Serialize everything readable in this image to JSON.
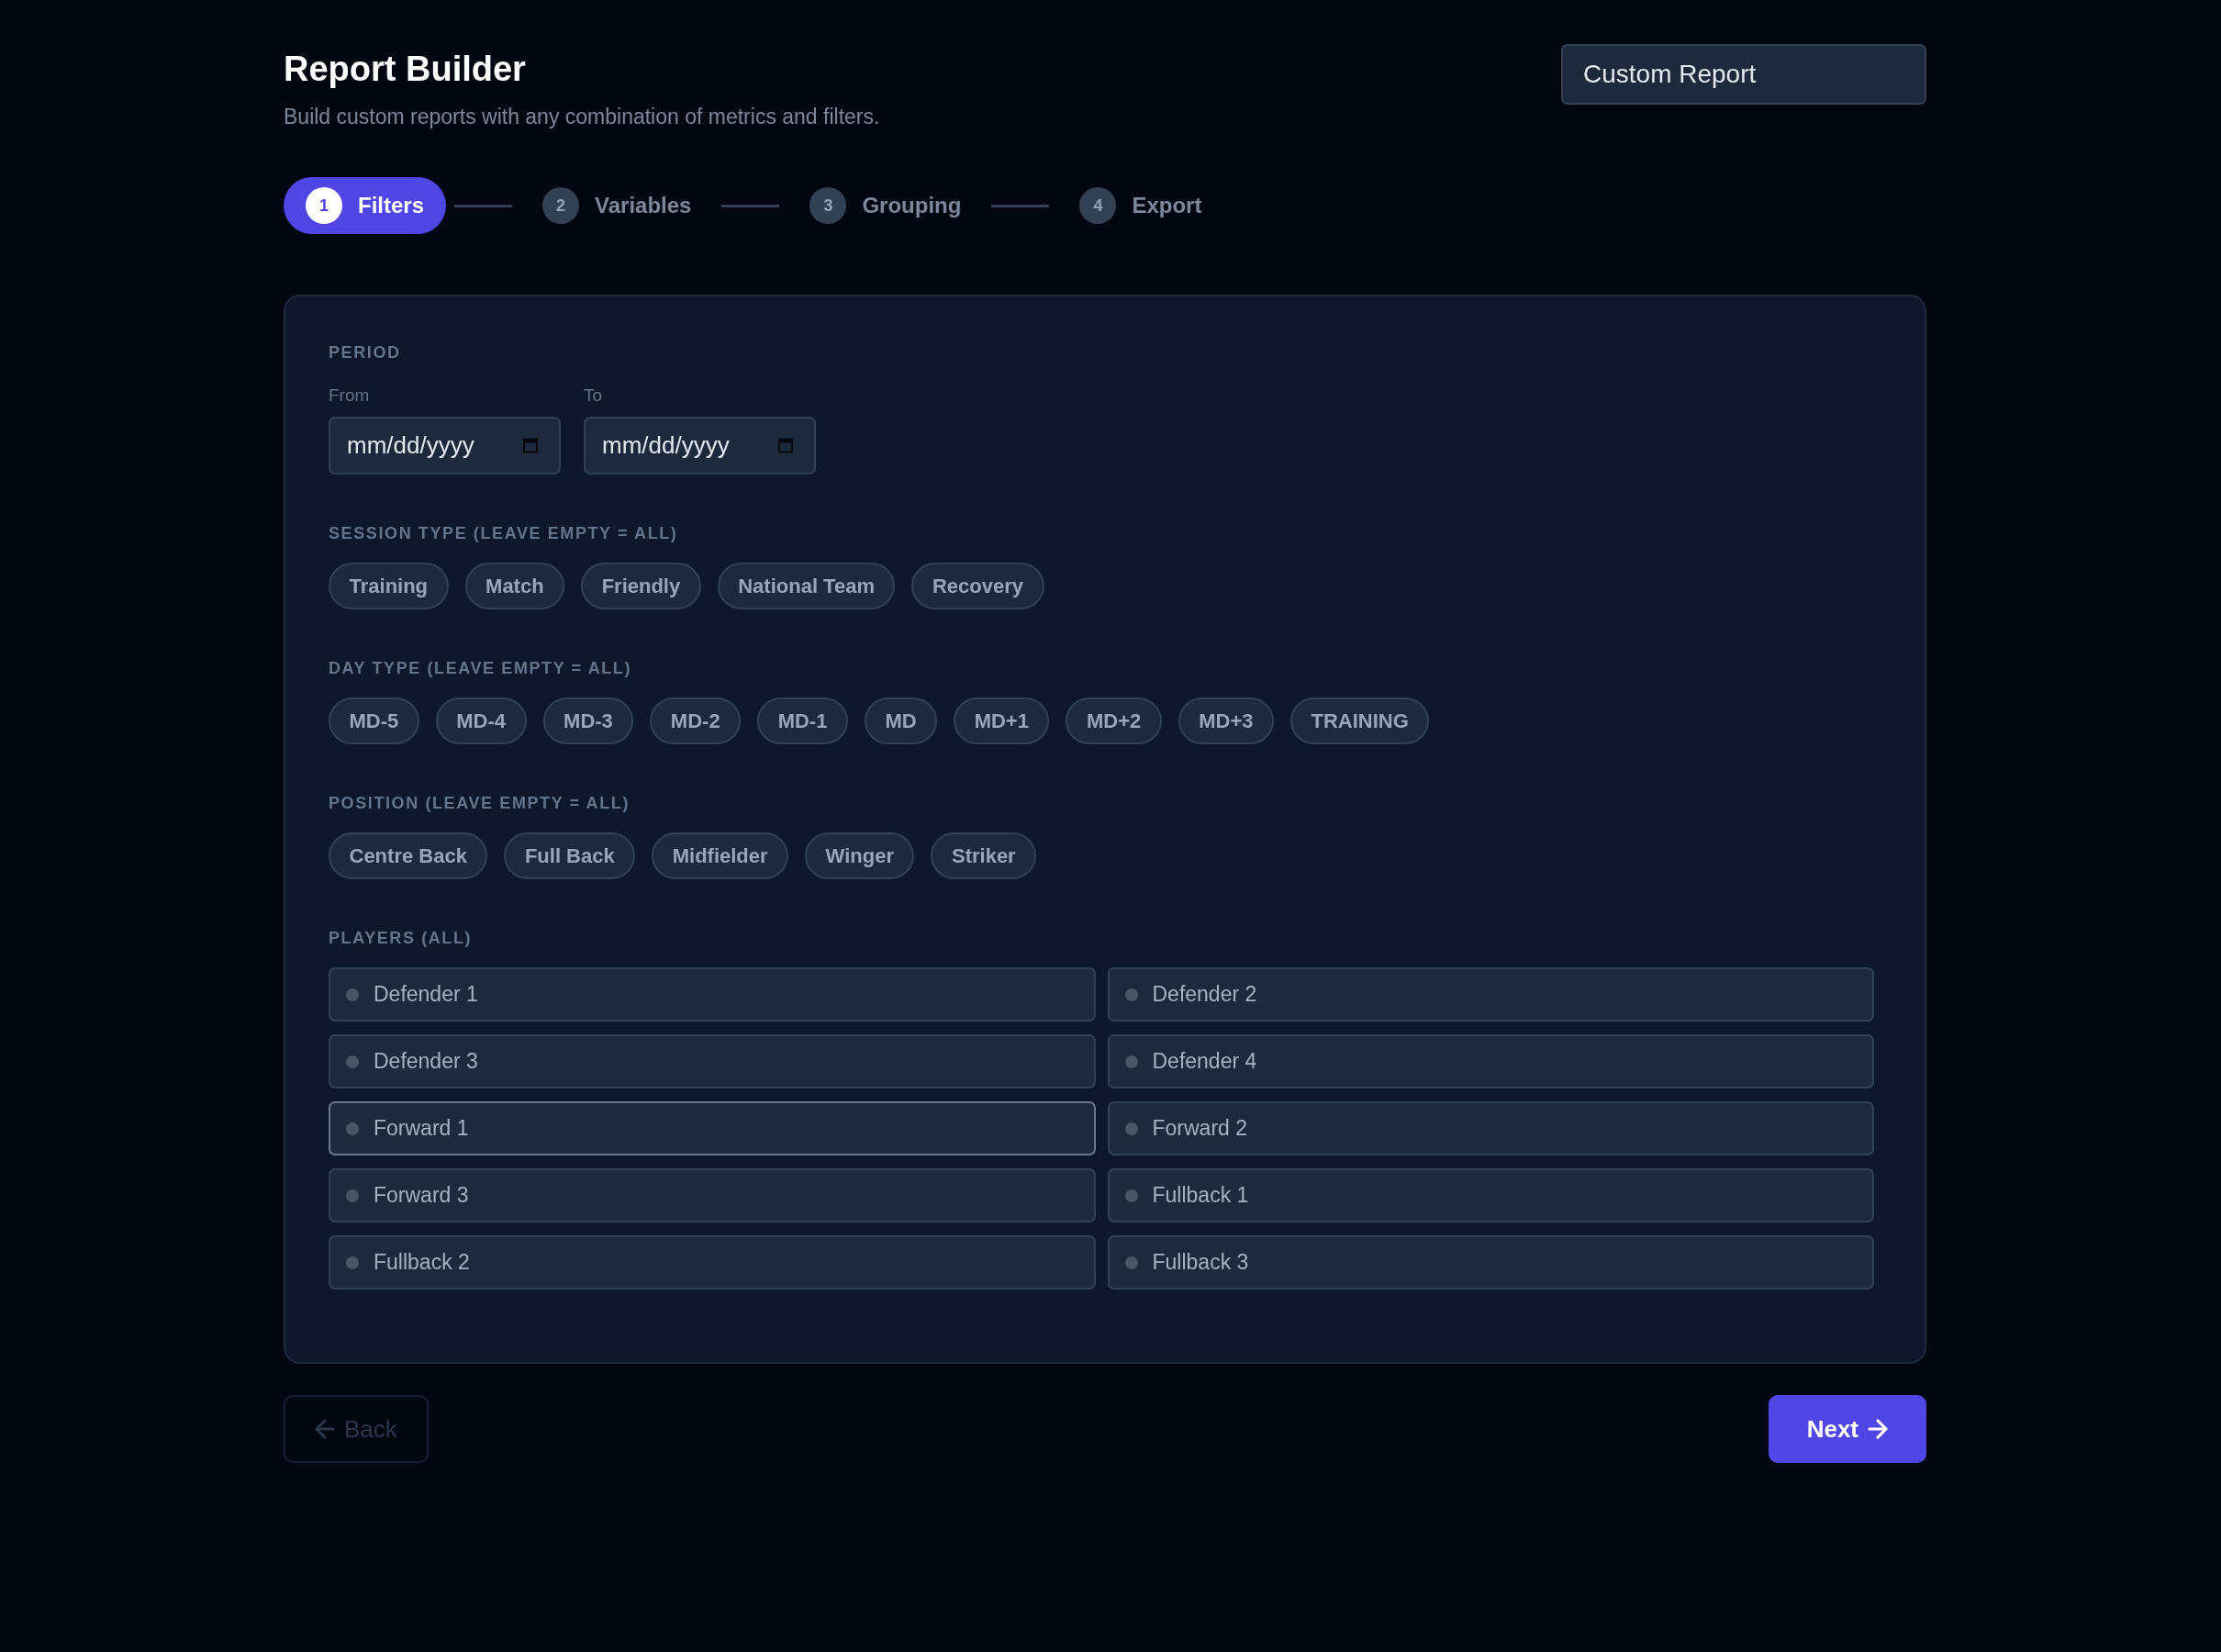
{
  "header": {
    "title": "Report Builder",
    "subtitle": "Build custom reports with any combination of metrics and filters."
  },
  "report_name": {
    "value": "Custom Report"
  },
  "steps": [
    {
      "number": "1",
      "label": "Filters",
      "selected": true
    },
    {
      "number": "2",
      "label": "Variables",
      "selected": false
    },
    {
      "number": "3",
      "label": "Grouping",
      "selected": false
    },
    {
      "number": "4",
      "label": "Export",
      "selected": false
    }
  ],
  "period": {
    "label": "PERIOD",
    "fields": [
      {
        "label": "From",
        "placeholder": "mm/dd/yyyy"
      },
      {
        "label": "To",
        "placeholder": "mm/dd/yyyy"
      }
    ]
  },
  "chip_groups": [
    {
      "label": "SESSION TYPE (LEAVE EMPTY = ALL)",
      "chips": [
        {
          "label": "Training",
          "selected": false
        },
        {
          "label": "Match",
          "selected": false
        },
        {
          "label": "Friendly",
          "selected": false
        },
        {
          "label": "National Team",
          "selected": false
        },
        {
          "label": "Recovery",
          "selected": false
        }
      ]
    },
    {
      "label": "DAY TYPE (LEAVE EMPTY = ALL)",
      "chips": [
        {
          "label": "MD-5",
          "selected": false
        },
        {
          "label": "MD-4",
          "selected": false
        },
        {
          "label": "MD-3",
          "selected": false
        },
        {
          "label": "MD-2",
          "selected": false
        },
        {
          "label": "MD-1",
          "selected": false
        },
        {
          "label": "MD",
          "selected": false
        },
        {
          "label": "MD+1",
          "selected": false
        },
        {
          "label": "MD+2",
          "selected": false
        },
        {
          "label": "MD+3",
          "selected": false
        },
        {
          "label": "TRAINING",
          "selected": false
        }
      ]
    },
    {
      "label": "POSITION (LEAVE EMPTY = ALL)",
      "chips": [
        {
          "label": "Centre Back",
          "selected": false
        },
        {
          "label": "Full Back",
          "selected": false
        },
        {
          "label": "Midfielder",
          "selected": false
        },
        {
          "label": "Winger",
          "selected": false
        },
        {
          "label": "Striker",
          "selected": false
        }
      ]
    }
  ],
  "players": {
    "label": "PLAYERS (ALL)",
    "items": [
      {
        "name": "Defender 1",
        "selected": false,
        "focused": false
      },
      {
        "name": "Defender 2",
        "selected": false,
        "focused": false
      },
      {
        "name": "Defender 3",
        "selected": false,
        "focused": false
      },
      {
        "name": "Defender 4",
        "selected": false,
        "focused": false
      },
      {
        "name": "Forward 1",
        "selected": false,
        "focused": true
      },
      {
        "name": "Forward 2",
        "selected": false,
        "focused": false
      },
      {
        "name": "Forward 3",
        "selected": false,
        "focused": false
      },
      {
        "name": "Fullback 1",
        "selected": false,
        "focused": false
      },
      {
        "name": "Fullback 2",
        "selected": false,
        "focused": false
      },
      {
        "name": "Fullback 3",
        "selected": false,
        "focused": false
      }
    ]
  },
  "buttons": [
    {
      "kind": "back",
      "label": "Back",
      "disabled": true
    },
    {
      "kind": "next",
      "label": "Next",
      "disabled": false
    }
  ]
}
